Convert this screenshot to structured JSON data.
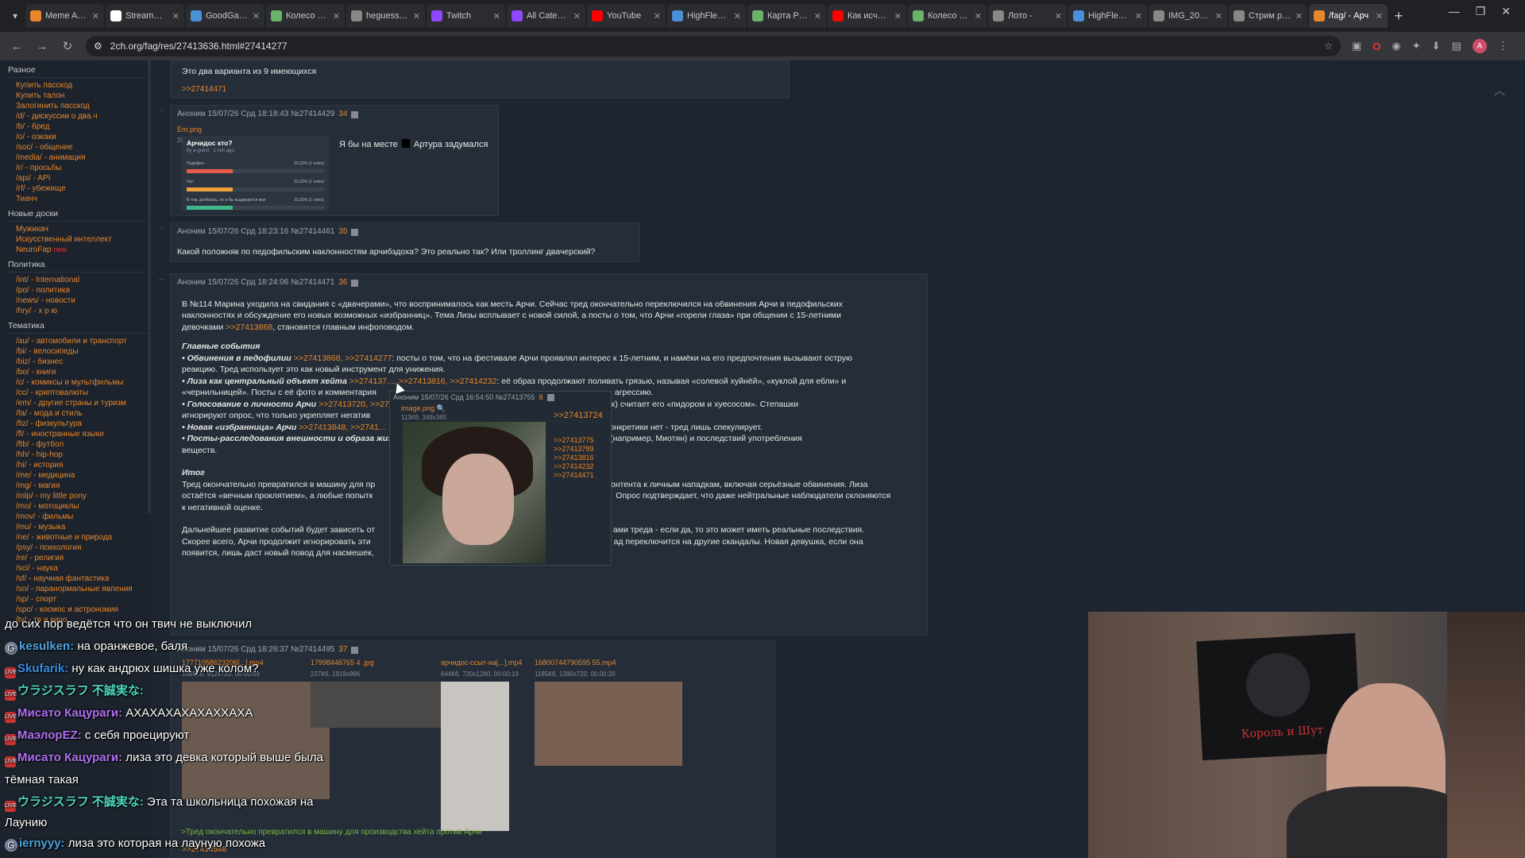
{
  "tabs": [
    {
      "label": "Meme Aleri",
      "color": "#e8862b"
    },
    {
      "label": "StreamElem",
      "color": "#ffffff"
    },
    {
      "label": "GoodGame",
      "color": "#4a90d9"
    },
    {
      "label": "Колесо слу",
      "color": "#6bb36b"
    },
    {
      "label": "heguess - y",
      "color": "#888888"
    },
    {
      "label": "Twitch",
      "color": "#9146ff"
    },
    {
      "label": "All Categori",
      "color": "#9146ff"
    },
    {
      "label": "YouTube",
      "color": "#ff0000"
    },
    {
      "label": "HighFleet o",
      "color": "#4a90d9"
    },
    {
      "label": "Карта РУ Тв",
      "color": "#6bb36b"
    },
    {
      "label": "Как исчезн",
      "color": "#ff0000"
    },
    {
      "label": "Колесо слу",
      "color": "#6bb36b"
    },
    {
      "label": "Лото -",
      "color": "#888888"
    },
    {
      "label": "HighFleet o",
      "color": "#4a90d9"
    },
    {
      "label": "IMG_20260",
      "color": "#888888"
    },
    {
      "label": "Стрим рирі",
      "color": "#888888"
    },
    {
      "label": "/fag/ - Арч",
      "color": "#e8862b",
      "active": true
    }
  ],
  "address": {
    "url": "2ch.org/fag/res/27413636.html#27414277"
  },
  "sidebar": {
    "sections": [
      {
        "title": "Разное",
        "items": [
          "Купить пасскод",
          "Купить талон",
          "Залогинить пасскод",
          "/d/ - дискуссии о два.ч",
          "/b/ - бред",
          "/o/ - оэкаки",
          "/soc/ - общение",
          "/media/ - анимация",
          "/r/ - просьбы",
          "/api/ - API",
          "/rf/ - убежище",
          "Тиачч"
        ]
      },
      {
        "title": "Новые доски",
        "items": [
          "Мужикач",
          "Искусственный интеллект",
          "NeuroFap"
        ]
      },
      {
        "title": "Политика",
        "items": [
          "/int/ - International",
          "/po/ - политика",
          "/news/ - новости",
          "/hry/ - х р ю"
        ]
      },
      {
        "title": "Тематика",
        "items": [
          "/au/ - автомобили и транспорт",
          "/bi/ - велосипеды",
          "/biz/ - бизнес",
          "/bo/ - книги",
          "/c/ - комиксы и мультфильмы",
          "/cc/ - криптовалюты",
          "/em/ - другие страны и туризм",
          "/fa/ - мода и стиль",
          "/fiz/ - физкультура",
          "/fl/ - иностранные языки",
          "/ftb/ - футбол",
          "/hh/ - hip-hop",
          "/hi/ - история",
          "/me/ - медицина",
          "/mg/ - магия",
          "/mlp/ - my little pony",
          "/mo/ - мотоциклы",
          "/mov/ - фильмы",
          "/mu/ - музыка",
          "/ne/ - животные и природа",
          "/psy/ - психология",
          "/re/ - религия",
          "/sci/ - наука",
          "/sf/ - научная фантастика",
          "/sn/ - паранормальные явления",
          "/sp/ - спорт",
          "/spc/ - космос и астрономия",
          "/tv/ - тв и кино"
        ]
      }
    ],
    "new_label": "new"
  },
  "posts": {
    "p0": {
      "text": "Это два варианта из 9 имеющихся",
      "reply": ">>27414471"
    },
    "p1": {
      "head": "Аноним 15/07/26 Срд 18:18:43 №27414429",
      "count": "34",
      "file": "Em.png",
      "meta": "20Кб, 559x285",
      "text": "Я бы на месте",
      "text2": "Артура задумался",
      "poll_title": "Арчидос кто?",
      "poll_by": "by a-guest · 1 min ago",
      "poll_rows": [
        "Педофил",
        "Чел",
        "В том, долбаюсь, но и бы выдираются мне"
      ],
      "poll_pcts": [
        "33,33% (1 votes)",
        "33,33% (1 votes)",
        "33,33% (1 votes)"
      ],
      "poll_colors": [
        "#e85c4a",
        "#f0a13c",
        "#3fb98a"
      ]
    },
    "p2": {
      "head": "Аноним 15/07/26 Срд 18:23:16 №27414461",
      "count": "35",
      "text": "Какой положняк по педофильским наклонностям арчибздоха? Это реально так? Или троллинг двачерский?"
    },
    "p3": {
      "head": "Аноним 15/07/26 Срд 18:24:06 №27414471",
      "count": "36",
      "para1a": "В №114 Марина уходила на свидания с «двачерами», что воспринималось как месть Арчи. Сейчас тред окончательно переключился на обвинения Арчи в педофильских",
      "para1b": "наклонностях и обсуждение его новых возможных «избранниц». Тема Лизы всплывает с новой силой, а посты о том, что Арчи «горели глаза» при общении с 15-летними",
      "para1c": "девочками",
      "para1c_ref": ">>27413868",
      "para1c_end": ", становятся главным инфоповодом.",
      "h1": "Главные события",
      "b1a": "• Обвинения в педофилии",
      "b1_refs": ">>27413868, >>27414277",
      "b1b": ": посты о том, что на фестивале Арчи проявлял интерес к 15-летним, и намёки на его предпочтения вызывают острую",
      "b1c": "реакцию. Тред использует это как новый инструмент для унижения.",
      "b2a": "• Лиза как центральный объект хейта",
      "b2_refs": ">>274137..., >>27413816, >>27414232",
      "b2b": ": её образ продолжают поливать грязью, называя «солевой хуйнёй», «куклой для ебли» и",
      "b2c": "«чернильницей». Посты с её фото и комментария",
      "b2c_end": "агрессию.",
      "b3a": "• Голосование о личности Арчи",
      "b3_refs": ">>27413720, >>27...",
      "b3b": "рианты, кроме двух) считает его «пидором и хуесосом». Степашки",
      "b3c": "игнорируют опрос, что только укрепляет негатив",
      "b4a": "• Новая «избранница» Арчи",
      "b4_refs": ">>27413848, >>2741...",
      "b4b": "ка, но конкретики нет - тред лишь спекулирует.",
      "b5a": "• Посты-расследования внешности и образа жиз",
      "b5b": "я стримерш (например, Миотян) и последствий употребления",
      "b5c": "веществ.",
      "h2": "Итог",
      "it1": "Тред окончательно превратился в машину для пр",
      "it1b": "контента к личным нападкам, включая серьёзные обвинения. Лиза",
      "it2": "остаётся «вечным проклятием», а любые попытк",
      "it2b": "Опрос подтверждает, что даже нейтральные наблюдатели склоняются",
      "it3": "к негативной оценке.",
      "fin1": "Дальнейшее развитие событий будет зависеть от",
      "fin1b": "ами треда - если да, то это может иметь реальные последствия.",
      "fin2": "Скорее всего, Арчи продолжит игнорировать эти",
      "fin2b": "ад переключится на другие скандалы. Новая девушка, если она",
      "fin3": "появится, лишь даст новый повод для насмешек,"
    },
    "p4": {
      "head": "Аноним 15/07/26 Срд 18:26:37 №27414495",
      "count": "37",
      "files": [
        {
          "name": "17771058623206[...].mp4",
          "meta": "1085Кб, 912x720, 00:00:09"
        },
        {
          "name": "17998446765 4 .jpg",
          "meta": "227Кб, 1919x996"
        },
        {
          "name": "арчидос-ссыт-на[...].mp4",
          "meta": "644Кб, 720x1280, 00:00:19"
        },
        {
          "name": "16800744790595 55.mp4",
          "meta": "1185Кб, 1280x720, 00:00:20"
        }
      ],
      "reply": ">>27414548"
    }
  },
  "popup": {
    "head": "Аноним 15/07/26 Срд 16:54:50 №27413755",
    "count": "8",
    "file": "image.png",
    "meta": "113Кб, 348x365",
    "main_ref": ">>27413724",
    "refs": [
      ">>27413775",
      ">>27413789",
      ">>27413816",
      ">>27414232",
      ">>27414471"
    ]
  },
  "tail_text": ">Тред окончательно превратился в машину для производства хейта против Арчи",
  "chat": [
    {
      "user": "",
      "color": "#ffffff",
      "text": "до сих пор ведётся что он твич не выключил"
    },
    {
      "user": "kesulken:",
      "color": "#4fa3e0",
      "text": "на оранжевое, баля",
      "badge": "G"
    },
    {
      "user": "Skufarik:",
      "color": "#3a8ee6",
      "text": "ну как андрюх шишка уже колом?",
      "badge": "LIVE"
    },
    {
      "user": "ウラジスラフ 不誠実な:",
      "color": "#4ed6c0",
      "text": "",
      "badge": "LIVE"
    },
    {
      "user": "Мисато Кацураги:",
      "color": "#b070f0",
      "text": "АХАХАХАХАХАХХАХА",
      "badge": "LIVE"
    },
    {
      "user": "МаэлорEZ:",
      "color": "#b070f0",
      "text": "с себя проецируют",
      "badge": "LIVE"
    },
    {
      "user": "Мисато Кацураги:",
      "color": "#b070f0",
      "text": "лиза это девка который выше была",
      "badge": "LIVE"
    },
    {
      "user": "",
      "color": "#ffffff",
      "text": "тёмная такая"
    },
    {
      "user": "ウラジスラフ 不誠実な:",
      "color": "#4ed6c0",
      "text": "Эта та школьница похожая на",
      "badge": "LIVE"
    },
    {
      "user": "",
      "color": "#ffffff",
      "text": "Лаунию"
    },
    {
      "user": "iernyyy:",
      "color": "#4fa3e0",
      "text": "лиза это которая на лауную похожа",
      "badge": "G"
    }
  ],
  "webcam": {
    "flag_text": "Король и Шут"
  }
}
